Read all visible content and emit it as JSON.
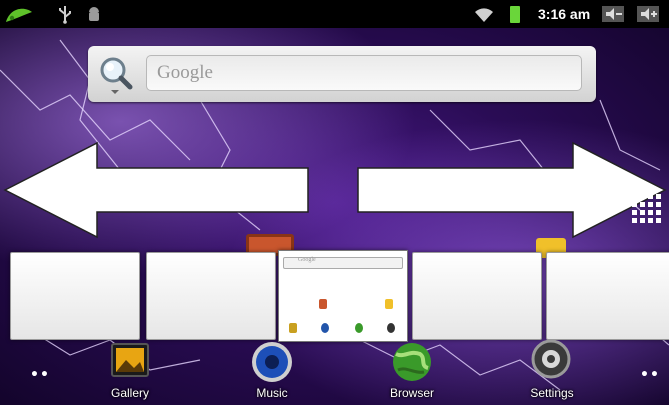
{
  "status_bar": {
    "time": "3:16 am",
    "icons": [
      "launcher-leaf-icon",
      "usb-icon",
      "android-debug-icon",
      "wifi-icon",
      "battery-icon",
      "volume-down-icon",
      "volume-up-icon"
    ]
  },
  "search": {
    "placeholder": "Google",
    "icon": "search-icon"
  },
  "mini_search": {
    "placeholder": "Google"
  },
  "navigation": {
    "left_arrow": "arrow-left-icon",
    "right_arrow": "arrow-right-icon",
    "app_drawer": "app-drawer-grid-icon"
  },
  "dock": {
    "items": [
      {
        "label": "Gallery",
        "icon": "gallery-icon"
      },
      {
        "label": "Music",
        "icon": "music-icon"
      },
      {
        "label": "Browser",
        "icon": "browser-globe-icon"
      },
      {
        "label": "Settings",
        "icon": "settings-icon"
      }
    ]
  },
  "colors": {
    "status_bar": "#000000",
    "battery": "#6ad63a",
    "wallpaper": "#2a0c55"
  }
}
